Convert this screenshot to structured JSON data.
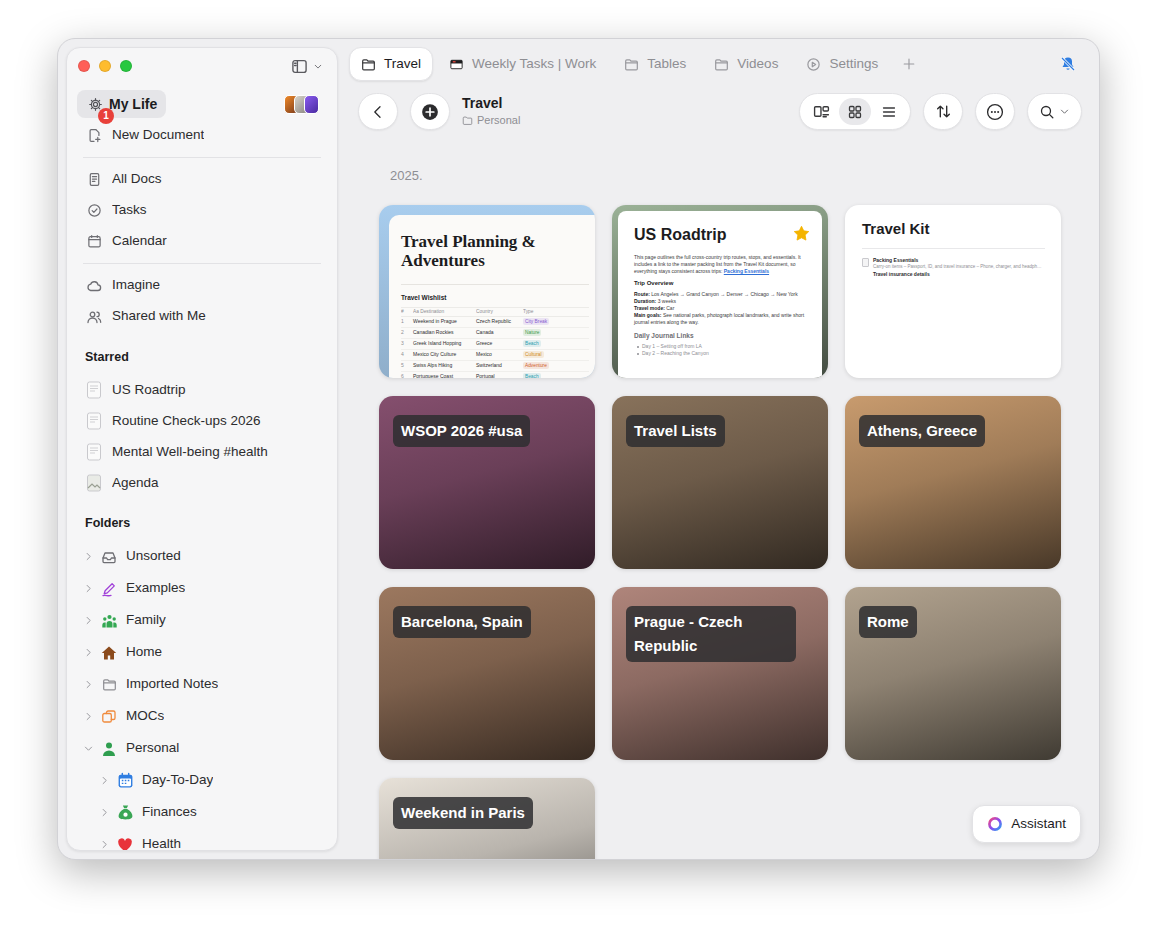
{
  "sidebar": {
    "workspace": {
      "label": "My Life",
      "selected": true,
      "badge": "1"
    },
    "new_document": "New Document",
    "nav": [
      {
        "label": "All Docs"
      },
      {
        "label": "Tasks"
      },
      {
        "label": "Calendar"
      }
    ],
    "nav2": [
      {
        "label": "Imagine"
      },
      {
        "label": "Shared with Me"
      }
    ],
    "starred": {
      "heading": "Starred",
      "items": [
        {
          "label": "US Roadtrip"
        },
        {
          "label": "Routine Check-ups 2026"
        },
        {
          "label": "Mental Well-being #health"
        },
        {
          "label": "Agenda"
        }
      ]
    },
    "folders": {
      "heading": "Folders",
      "items": [
        {
          "label": "Unsorted",
          "expanded": false,
          "depth": 0,
          "color": "#6e6e73"
        },
        {
          "label": "Examples",
          "expanded": false,
          "depth": 0,
          "color": "#a040d8"
        },
        {
          "label": "Family",
          "expanded": false,
          "depth": 0,
          "color": "#34a853"
        },
        {
          "label": "Home",
          "expanded": false,
          "depth": 0,
          "color": "#8b4a1c"
        },
        {
          "label": "Imported Notes",
          "expanded": false,
          "depth": 0,
          "color": "#8e8e93"
        },
        {
          "label": "MOCs",
          "expanded": false,
          "depth": 0,
          "color": "#f08a3c"
        },
        {
          "label": "Personal",
          "expanded": true,
          "depth": 0,
          "color": "#2f9e4f"
        },
        {
          "label": "Day-To-Day",
          "expanded": false,
          "depth": 1,
          "color": "#2f7de1"
        },
        {
          "label": "Finances",
          "expanded": false,
          "depth": 1,
          "color": "#3aa655"
        },
        {
          "label": "Health",
          "expanded": false,
          "depth": 1,
          "color": "#e8333a"
        }
      ]
    }
  },
  "tabs": [
    {
      "label": "Travel",
      "selected": true
    },
    {
      "label": "Weekly Tasks | Work",
      "selected": false
    },
    {
      "label": "Tables",
      "selected": false
    },
    {
      "label": "Videos",
      "selected": false
    },
    {
      "label": "Settings",
      "selected": false
    }
  ],
  "notifications": {
    "muted": true
  },
  "toolbar": {
    "title": "Travel",
    "folder": "Personal",
    "views": [
      {
        "selected": false
      },
      {
        "selected": true
      },
      {
        "selected": false
      }
    ]
  },
  "section": "2025.",
  "cards": [
    {
      "kind": "table",
      "title": "Travel Planning & Adventures",
      "color": "#a8cdee",
      "table": {
        "title": "Travel Wishlist",
        "columns": [
          "#",
          "Aa Destination",
          "Country",
          "Type"
        ],
        "rows": [
          {
            "cells": [
              "1",
              "Weekend in Prague",
              "Czech Republic"
            ],
            "tag": "City Break",
            "color": "#8a5cd0"
          },
          {
            "cells": [
              "2",
              "Canadian Rockies",
              "Canada"
            ],
            "tag": "Nature",
            "color": "#3f9a4a"
          },
          {
            "cells": [
              "3",
              "Greek Island Hopping",
              "Greece"
            ],
            "tag": "Beach",
            "color": "#2a9fb0"
          },
          {
            "cells": [
              "4",
              "Mexico City Culture",
              "Mexico"
            ],
            "tag": "Cultural",
            "color": "#d08a1e"
          },
          {
            "cells": [
              "5",
              "Swiss Alps Hiking",
              "Switzerland"
            ],
            "tag": "Adventure",
            "color": "#d0602a"
          },
          {
            "cells": [
              "6",
              "Portuguese Coast",
              "Portugal"
            ],
            "tag": "Beach",
            "color": "#2a9fb0"
          }
        ]
      }
    },
    {
      "kind": "outline",
      "title": "US Roadtrip",
      "starred": true,
      "color": "#6f7f6c",
      "intro": "This page outlines the full cross-country trip routes, stops, and essentials. It includes a link to the master packing list from the Travel Kit document, so everything stays consistent across trips:",
      "link": "Packing Essentials",
      "overview_heading": "Trip Overview",
      "facts": [
        {
          "label": "Route:",
          "value": "Los Angeles → Grand Canyon → Denver → Chicago → New York"
        },
        {
          "label": "Duration:",
          "value": "3 weeks"
        },
        {
          "label": "Travel mode:",
          "value": "Car"
        },
        {
          "label": "Main goals:",
          "value": "See national parks, photograph local landmarks, and write short journal entries along the way."
        }
      ],
      "journal_heading": "Daily Journal Links",
      "journal": [
        "Day 1 – Setting off from LA",
        "Day 2 – Reaching the Canyon"
      ]
    },
    {
      "kind": "list",
      "title": "Travel Kit",
      "color": "#ffffff",
      "block": {
        "heading": "Packing Essentials",
        "text": "Carry-on items – Passport, ID, and travel insurance – Phone, charger, and headph…",
        "footer": "Travel insurance details"
      }
    },
    {
      "kind": "photo",
      "title": "WSOP 2026 #usa",
      "color": "#6a3f58"
    },
    {
      "kind": "photo",
      "title": "Travel Lists",
      "color": "#6d5b49"
    },
    {
      "kind": "photo",
      "title": "Athens, Greece",
      "color": "#a07c58"
    },
    {
      "kind": "photo",
      "title": "Barcelona, Spain",
      "color": "#7d604c"
    },
    {
      "kind": "photo",
      "title": "Prague - Czech Republic",
      "color": "#8c6a62"
    },
    {
      "kind": "photo",
      "title": "Rome",
      "color": "#8e8272"
    },
    {
      "kind": "photo",
      "title": "Weekend in Paris",
      "color": "#b9b4ad"
    }
  ],
  "assistant": "Assistant"
}
